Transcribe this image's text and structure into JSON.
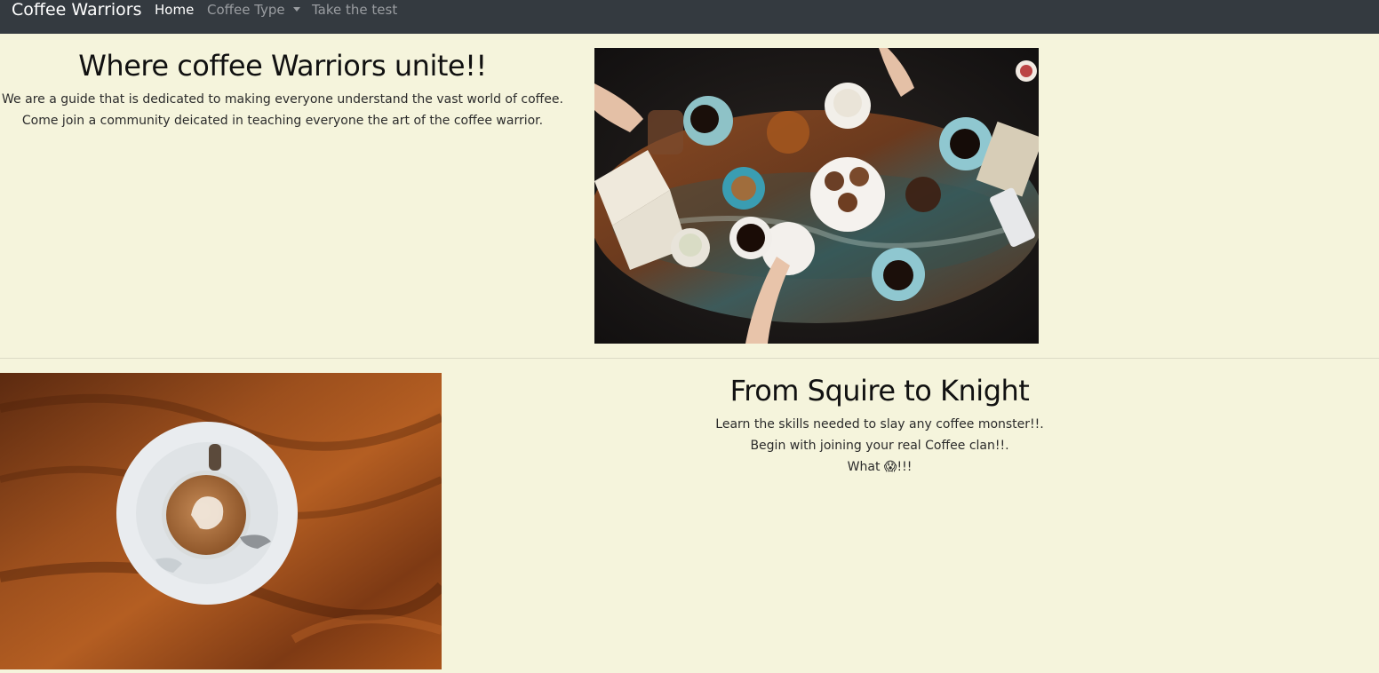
{
  "navbar": {
    "brand": "Coffee Warriors",
    "items": [
      {
        "label": "Home",
        "active": true
      },
      {
        "label": "Coffee Type",
        "dropdown": true
      },
      {
        "label": "Take the test"
      }
    ]
  },
  "section1": {
    "heading": "Where coffee Warriors unite!!",
    "lines": [
      "We are a guide that is dedicated to making everyone understand the vast world of coffee.",
      "Come join a community deicated in teaching everyone the art of the coffee warrior."
    ]
  },
  "section2": {
    "heading": "From Squire to Knight",
    "lines": [
      "Learn the skills needed to slay any coffee monster!!.",
      "Begin with joining your real Coffee clan!!.",
      "What 😱!!!"
    ]
  },
  "colors": {
    "navbar_bg": "#343a40",
    "page_bg": "#f5f4dc",
    "brand_text": "#ffffff",
    "nav_muted": "#9a9da1"
  },
  "images": {
    "top": "photo-coffee-table-overhead",
    "bottom": "photo-latte-on-wood"
  }
}
